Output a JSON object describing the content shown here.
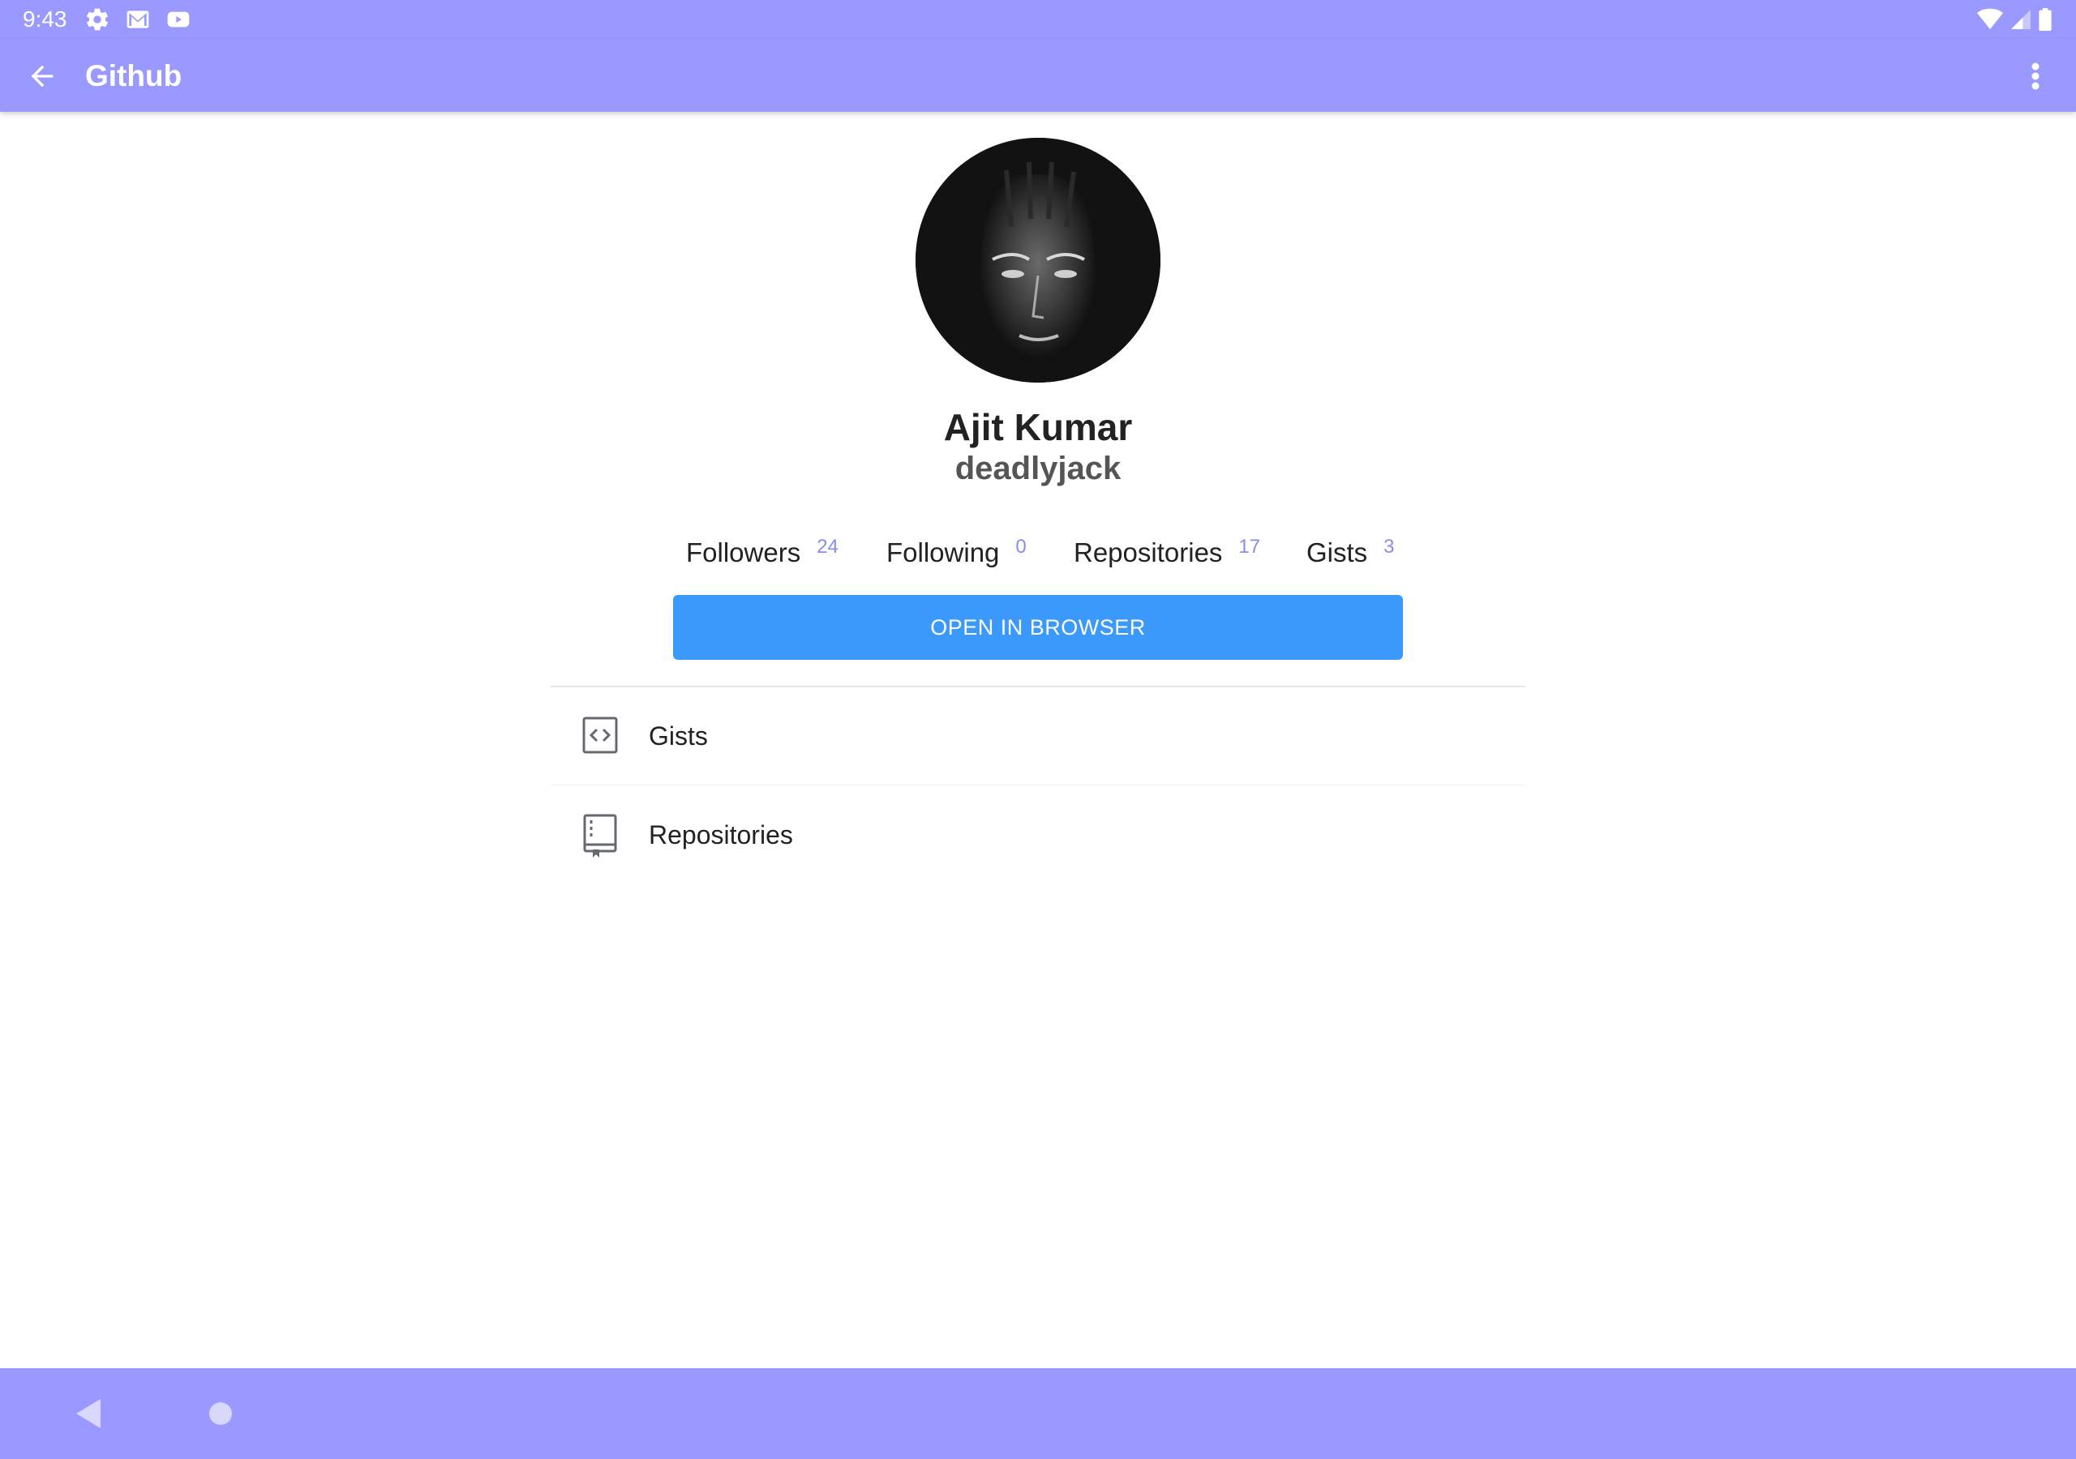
{
  "status_bar": {
    "time": "9:43",
    "left_icons": [
      "gear-icon",
      "gmail-icon",
      "youtube-icon"
    ],
    "right_icons": [
      "wifi-icon",
      "signal-icon",
      "battery-icon"
    ]
  },
  "app_bar": {
    "title": "Github",
    "back_icon": "arrow-back-icon",
    "menu_icon": "more-vert-icon"
  },
  "profile": {
    "name": "Ajit Kumar",
    "username": "deadlyjack"
  },
  "stats": [
    {
      "label": "Followers",
      "count": "24"
    },
    {
      "label": "Following",
      "count": "0"
    },
    {
      "label": "Repositories",
      "count": "17"
    },
    {
      "label": "Gists",
      "count": "3"
    }
  ],
  "open_button": {
    "label": "OPEN IN BROWSER"
  },
  "list": [
    {
      "label": "Gists",
      "icon": "code-icon"
    },
    {
      "label": "Repositories",
      "icon": "repo-book-icon"
    }
  ],
  "colors": {
    "primary": "#9999ff",
    "accent_button": "#3b99fc",
    "count_color": "#8a8af0"
  }
}
